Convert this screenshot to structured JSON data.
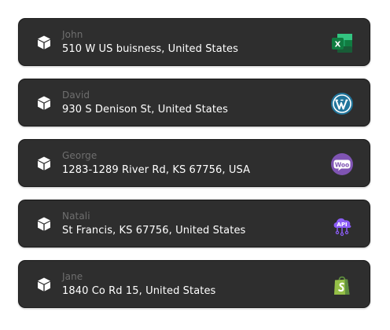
{
  "contacts": [
    {
      "name": "John",
      "address": "510 W US buisness, United States",
      "app_icon": "excel-icon"
    },
    {
      "name": "David",
      "address": "930 S Denison St, United States",
      "app_icon": "wordpress-icon"
    },
    {
      "name": "George",
      "address": "1283-1289 River Rd, KS 67756, USA",
      "app_icon": "woocommerce-icon"
    },
    {
      "name": "Natali",
      "address": "St Francis, KS 67756, United States",
      "app_icon": "api-cloud-icon"
    },
    {
      "name": "Jane",
      "address": "1840 Co Rd 15, United States",
      "app_icon": "shopify-icon"
    }
  ],
  "icon_labels": {
    "excel": "X",
    "woocommerce": "Woo",
    "api": "API"
  },
  "colors": {
    "card_background": "#2e2e2e",
    "name_text": "#6f6f6f",
    "address_text": "#ffffff",
    "excel_green": "#1f7244",
    "wordpress_blue": "#21759b",
    "woocommerce_purple": "#7f54b3",
    "api_purple": "#8b5cf6",
    "shopify_green": "#95bf47"
  }
}
